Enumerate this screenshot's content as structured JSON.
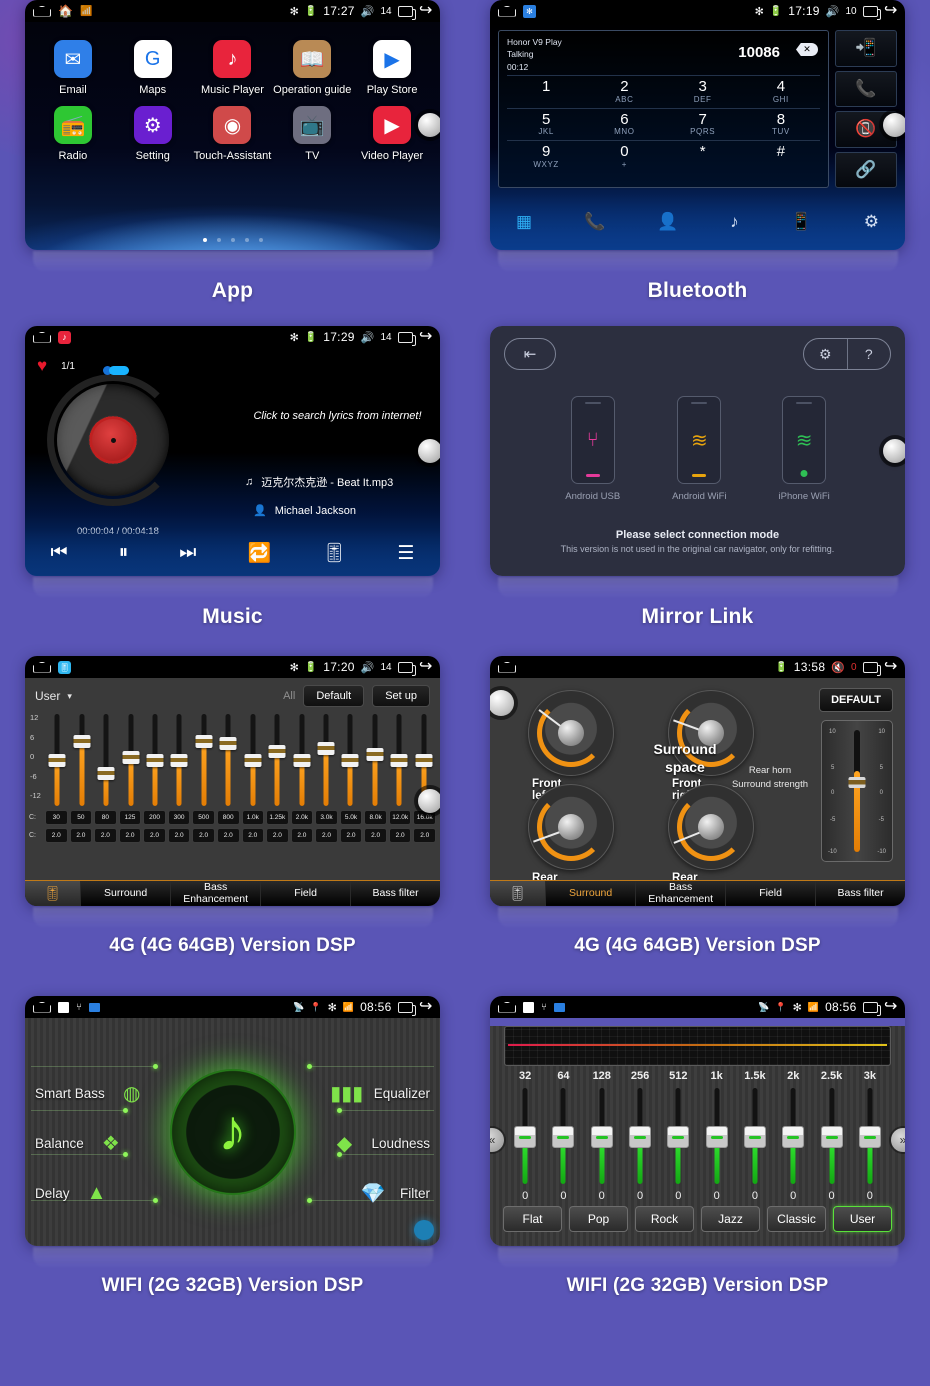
{
  "background_color": "#5a55b6",
  "panels": [
    {
      "id": "app",
      "caption": "App",
      "status": {
        "time": "17:27",
        "volume": "14",
        "bluetooth_icon": "bluetooth-icon",
        "battery_icon": "battery-icon",
        "speaker_icon": "volume-icon",
        "recents_icon": "recents-icon",
        "back_icon": "back-icon",
        "home_icon": "home-icon"
      },
      "apps": [
        {
          "label": "Email",
          "icon": "email-icon",
          "glyph": "✉",
          "bg": "#2f7fe8"
        },
        {
          "label": "Maps",
          "icon": "maps-icon",
          "glyph": "G",
          "bg": "#ffffff"
        },
        {
          "label": "Music Player",
          "icon": "music-note-icon",
          "glyph": "♪",
          "bg": "#e8243c"
        },
        {
          "label": "Operation guide",
          "icon": "book-icon",
          "glyph": "📖",
          "bg": "#b98a55"
        },
        {
          "label": "Play Store",
          "icon": "play-store-icon",
          "glyph": "▶",
          "bg": "#ffffff"
        },
        {
          "label": "Radio",
          "icon": "radio-icon",
          "glyph": "📻",
          "bg": "#2ec733"
        },
        {
          "label": "Setting",
          "icon": "gear-icon",
          "glyph": "⚙",
          "bg": "#6a1fd0"
        },
        {
          "label": "Touch-Assistant",
          "icon": "touch-circle-icon",
          "glyph": "◉",
          "bg": "#d04a4a"
        },
        {
          "label": "TV",
          "icon": "tv-icon",
          "glyph": "📺",
          "bg": "#6e6e80"
        },
        {
          "label": "Video Player",
          "icon": "video-play-icon",
          "glyph": "▶",
          "bg": "#e8243c"
        }
      ],
      "page_dots": 5,
      "active_dot": 0
    },
    {
      "id": "bluetooth",
      "caption": "Bluetooth",
      "status": {
        "time": "17:19",
        "volume": "10"
      },
      "call": {
        "device": "Honor V9 Play",
        "state": "Talking",
        "duration": "00:12",
        "number": "10086",
        "delete_icon": "backspace-icon"
      },
      "keys": [
        {
          "digit": "1",
          "letters": ""
        },
        {
          "digit": "2",
          "letters": "ABC"
        },
        {
          "digit": "3",
          "letters": "DEF"
        },
        {
          "digit": "4",
          "letters": "GHI"
        },
        {
          "digit": "5",
          "letters": "JKL"
        },
        {
          "digit": "6",
          "letters": "MNO"
        },
        {
          "digit": "7",
          "letters": "PQRS"
        },
        {
          "digit": "8",
          "letters": "TUV"
        },
        {
          "digit": "9",
          "letters": "WXYZ"
        },
        {
          "digit": "0",
          "letters": "+"
        },
        {
          "digit": "*",
          "letters": ""
        },
        {
          "digit": "#",
          "letters": ""
        }
      ],
      "side_buttons": [
        {
          "name": "transfer-audio-icon",
          "glyph": "📲"
        },
        {
          "name": "call-answer-icon",
          "glyph": "📞"
        },
        {
          "name": "call-end-icon",
          "glyph": "📵"
        },
        {
          "name": "link-icon",
          "glyph": "🔗"
        }
      ],
      "tabs": [
        {
          "name": "dialpad-tab",
          "glyph": "▦",
          "active": true
        },
        {
          "name": "call-log-tab",
          "glyph": "📞",
          "active": false
        },
        {
          "name": "contacts-tab",
          "glyph": "👤",
          "active": false
        },
        {
          "name": "bluetooth-music-tab",
          "glyph": "♪",
          "active": false
        },
        {
          "name": "sync-tab",
          "glyph": "📱",
          "active": false
        },
        {
          "name": "settings-tab",
          "glyph": "⚙",
          "active": false
        }
      ]
    },
    {
      "id": "music",
      "caption": "Music",
      "status": {
        "time": "17:29",
        "volume": "14"
      },
      "favorite_icon": "heart-icon",
      "track_count": "1/1",
      "lyrics_hint": "Click to search lyrics from internet!",
      "track_title": "迈克尔杰克逊 - Beat It.mp3",
      "artist": "Michael Jackson",
      "time": "00:00:04 / 00:04:18",
      "controls": [
        {
          "name": "previous-button",
          "glyph": "⏮"
        },
        {
          "name": "pause-button",
          "glyph": "⏸"
        },
        {
          "name": "next-button",
          "glyph": "⏭"
        },
        {
          "name": "repeat-button",
          "glyph": "🔁"
        },
        {
          "name": "equalizer-button",
          "glyph": "🎚"
        },
        {
          "name": "playlist-button",
          "glyph": "☰"
        }
      ]
    },
    {
      "id": "mirror",
      "caption": "Mirror Link",
      "exit_icon": "exit-icon",
      "settings_icon": "gear-icon",
      "help_icon": "help-icon",
      "modes": [
        {
          "label": "Android USB",
          "icon": "usb-icon",
          "glyph": "⑂",
          "color": "#e53a9a"
        },
        {
          "label": "Android WiFi",
          "icon": "wifi-icon",
          "glyph": "≋",
          "color": "#e8a40d"
        },
        {
          "label": "iPhone WiFi",
          "icon": "wifi-icon",
          "glyph": "≋",
          "color": "#2fbf55"
        }
      ],
      "prompt": "Please select connection mode",
      "note": "This version is not used in the original car navigator, only for refitting."
    },
    {
      "id": "eq16",
      "caption": "4G (4G 64GB) Version DSP",
      "status": {
        "time": "17:20",
        "volume": "14"
      },
      "preset_label": "User",
      "all_label": "All",
      "default_button": "Default",
      "setup_button": "Set up",
      "db_scale": [
        "12",
        "6",
        "0",
        "-6",
        "-12"
      ],
      "freq_row_label": "C:",
      "gain_row_label": "C:",
      "frequencies": [
        "30",
        "50",
        "80",
        "125",
        "200",
        "300",
        "500",
        "800",
        "1.0k",
        "1.25k",
        "2.0k",
        "3.0k",
        "5.0k",
        "8.0k",
        "12.0k",
        "16.0k"
      ],
      "gains": [
        "2.0",
        "2.0",
        "2.0",
        "2.0",
        "2.0",
        "2.0",
        "2.0",
        "2.0",
        "2.0",
        "2.0",
        "2.0",
        "2.0",
        "2.0",
        "2.0",
        "2.0",
        "2.0"
      ],
      "slider_positions": [
        0,
        6,
        -4,
        1,
        0,
        0,
        6,
        5.5,
        0,
        3,
        0,
        4,
        0,
        2,
        0,
        0
      ],
      "tabs": [
        {
          "label": "",
          "icon": "equalizer-icon",
          "active": true
        },
        {
          "label": "Surround",
          "active": false
        },
        {
          "label": "Bass Enhancement",
          "active": false
        },
        {
          "label": "Field",
          "active": false
        },
        {
          "label": "Bass filter",
          "active": false
        }
      ]
    },
    {
      "id": "surround",
      "caption": "4G (4G 64GB) Version DSP",
      "status": {
        "time": "13:58",
        "volume": "0",
        "mute": true
      },
      "default_button": "DEFAULT",
      "center_label": "Surround space",
      "gauges": [
        {
          "label": "Front left",
          "angle": -143
        },
        {
          "label": "Front right",
          "angle": -160
        },
        {
          "label": "Rear left",
          "angle": 160
        },
        {
          "label": "Rear right",
          "angle": 158
        }
      ],
      "fader_label": "Rear horn Surround strength",
      "fader_scale": [
        "10",
        "5",
        "0",
        "-5",
        "-10"
      ],
      "tabs": [
        {
          "label": "",
          "icon": "equalizer-icon",
          "active": false
        },
        {
          "label": "Surround",
          "active": true
        },
        {
          "label": "Bass Enhancement",
          "active": false
        },
        {
          "label": "Field",
          "active": false
        },
        {
          "label": "Bass filter",
          "active": false
        }
      ]
    },
    {
      "id": "dsphub",
      "caption": "WIFI (2G 32GB) Version DSP",
      "status": {
        "time": "08:56"
      },
      "left_items": [
        {
          "label": "Smart Bass",
          "icon": "smart-bass-icon",
          "glyph": "◍"
        },
        {
          "label": "Balance",
          "icon": "balance-icon",
          "glyph": "❖"
        },
        {
          "label": "Delay",
          "icon": "delay-pyramid-icon",
          "glyph": "▲"
        }
      ],
      "right_items": [
        {
          "label": "Equalizer",
          "icon": "equalizer-bars-icon",
          "glyph": "▮▮▮"
        },
        {
          "label": "Loudness",
          "icon": "loudness-diamond-icon",
          "glyph": "◆"
        },
        {
          "label": "Filter",
          "icon": "filter-gem-icon",
          "glyph": "💎"
        }
      ],
      "center_icon": "music-note-icon"
    },
    {
      "id": "eq10",
      "caption": "WIFI (2G 32GB) Version DSP",
      "status": {
        "time": "08:56"
      },
      "frequencies": [
        "32",
        "64",
        "128",
        "256",
        "512",
        "1k",
        "1.5k",
        "2k",
        "2.5k",
        "3k"
      ],
      "values": [
        "0",
        "0",
        "0",
        "0",
        "0",
        "0",
        "0",
        "0",
        "0",
        "0"
      ],
      "presets": [
        {
          "label": "Flat",
          "selected": false
        },
        {
          "label": "Pop",
          "selected": false
        },
        {
          "label": "Rock",
          "selected": false
        },
        {
          "label": "Jazz",
          "selected": false
        },
        {
          "label": "Classic",
          "selected": false
        },
        {
          "label": "User",
          "selected": true
        }
      ],
      "prev_icon": "chevron-left-icon",
      "next_icon": "chevron-right-icon"
    }
  ]
}
